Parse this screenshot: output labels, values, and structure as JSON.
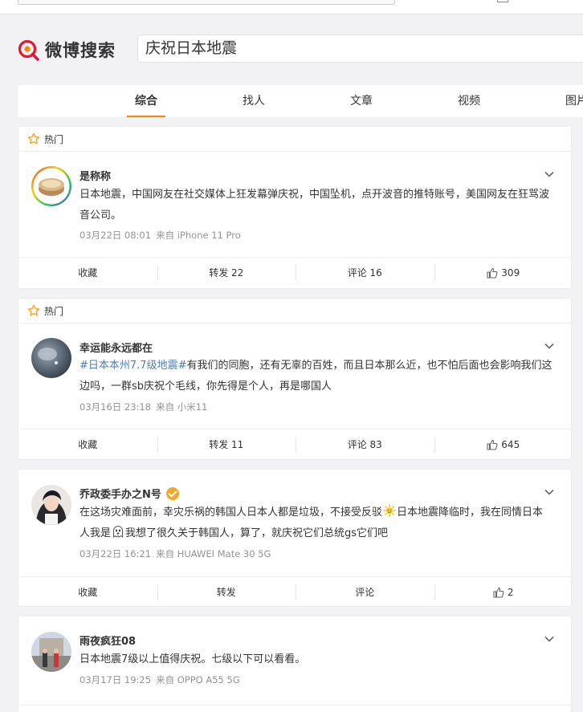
{
  "site": {
    "logo_text": "微博搜索"
  },
  "search": {
    "query": "庆祝日本地震"
  },
  "tabs": [
    {
      "label": "综合",
      "active": true
    },
    {
      "label": "找人"
    },
    {
      "label": "文章"
    },
    {
      "label": "视频"
    },
    {
      "label": "图片"
    }
  ],
  "posts": [
    {
      "hot_label": "热门",
      "username": "是称称",
      "verified": false,
      "text": "日本地震，中国网友在社交媒体上狂发幕弹庆祝，中国坠机，点开波音的推特账号，美国网友在狂骂波音公司。",
      "time": "03月22日 08:01",
      "source": "来自 iPhone 11 Pro",
      "fav": "收藏",
      "repost": "转发 22",
      "comment": "评论 16",
      "like": "309"
    },
    {
      "hot_label": "热门",
      "username": "幸运能永远都在",
      "verified": false,
      "hashtag": "#日本本州7.7级地震#",
      "text": "有我们的同胞，还有无辜的百姓，而且日本那么近，也不怕后面也会影响我们这边吗，一群sb庆祝个毛线，你先得是个人，再是哪国人",
      "time": "03月16日 23:18",
      "source": "来自 小米11",
      "fav": "收藏",
      "repost": "转发 11",
      "comment": "评论 83",
      "like": "645"
    },
    {
      "username": "乔政委手办之N号",
      "verified": true,
      "text_a": "在这场灾难面前，幸灾乐祸的韩国人日本人都是垃圾，不接受反驳",
      "text_b": "日本地震降临时，我在同情日本人我是",
      "text_c": "我想了很久关于韩国人，算了，就庆祝它们总统gs它们吧",
      "time": "03月22日 16:21",
      "source": "来自 HUAWEI Mate 30 5G",
      "fav": "收藏",
      "repost": "转发",
      "comment": "评论",
      "like": "2"
    },
    {
      "username": "雨夜疯狂08",
      "verified": false,
      "text": "日本地震7级以上值得庆祝。七级以下可以看看。",
      "time": "03月17日 19:25",
      "source": "来自 OPPO A55 5G"
    }
  ],
  "colors": {
    "accent": "#ff8200",
    "link": "#507daf",
    "meta": "#939393",
    "verify": "#f5a623"
  },
  "icons": [
    "star-outline-icon",
    "chevron-down-icon",
    "thumbs-up-icon",
    "weibo-search-logo-icon",
    "sun-emoji-icon",
    "ghost-emoji-icon"
  ]
}
